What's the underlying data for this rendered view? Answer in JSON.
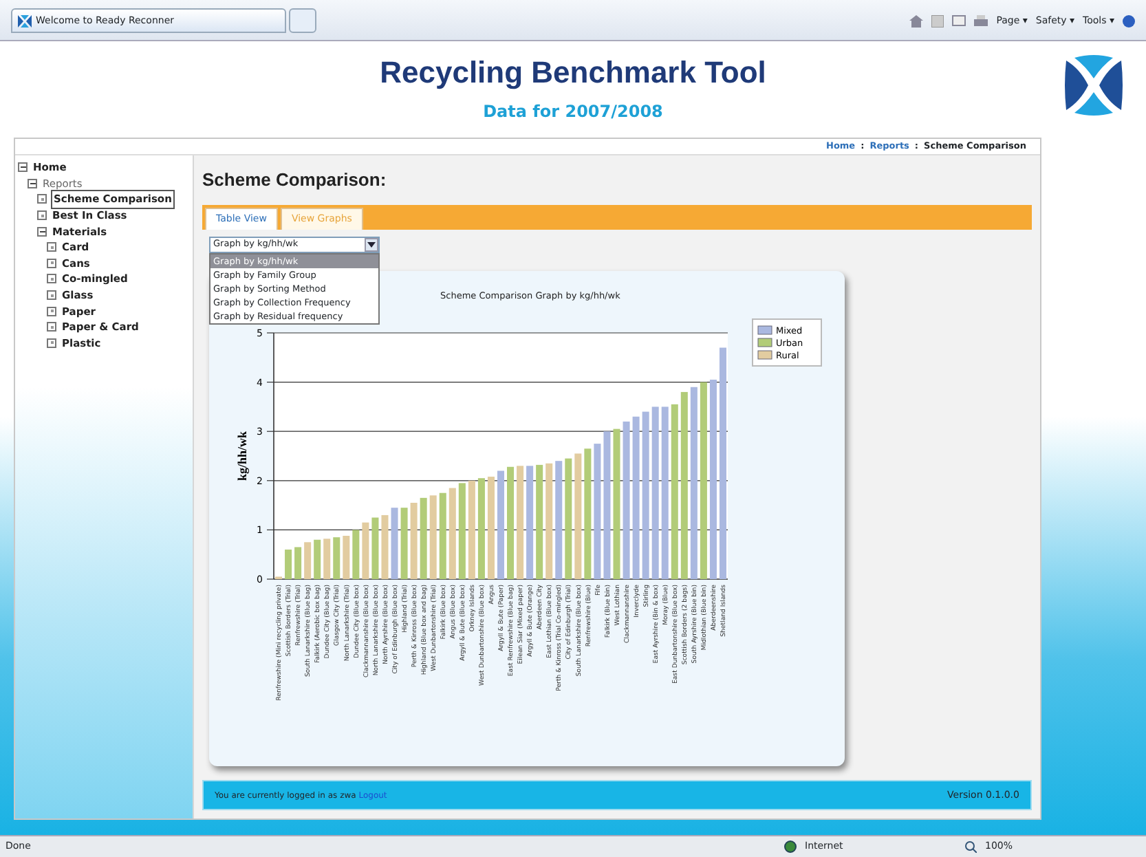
{
  "browser": {
    "tab_title": "Welcome to Ready Reconner",
    "toolbar": [
      "Page ▾",
      "Safety ▾",
      "Tools ▾"
    ],
    "status": "Done",
    "zone": "Internet",
    "zoom": "100%"
  },
  "header": {
    "title": "Recycling Benchmark Tool",
    "subtitle": "Data for 2007/2008"
  },
  "breadcrumb": {
    "items": [
      "Home",
      "Reports",
      "Scheme Comparison"
    ],
    "separator": ":"
  },
  "sidebar": {
    "items": [
      {
        "label": "Home",
        "expanded": true,
        "selected": false,
        "children": [
          {
            "label": "Reports",
            "expanded": true,
            "selected": false,
            "children": [
              {
                "label": "Scheme Comparison",
                "selected": true
              },
              {
                "label": "Best In Class",
                "selected": false
              },
              {
                "label": "Materials",
                "expanded": true,
                "selected": false,
                "children": [
                  {
                    "label": "Card",
                    "selected": false
                  },
                  {
                    "label": "Cans",
                    "selected": false
                  },
                  {
                    "label": "Co-mingled",
                    "selected": false
                  },
                  {
                    "label": "Glass",
                    "selected": false
                  },
                  {
                    "label": "Paper",
                    "selected": false
                  },
                  {
                    "label": "Paper & Card",
                    "selected": false
                  },
                  {
                    "label": "Plastic",
                    "selected": false
                  }
                ]
              }
            ]
          }
        ]
      }
    ]
  },
  "page_title": "Scheme Comparison:",
  "tabs": [
    {
      "label": "Table View",
      "selected": false
    },
    {
      "label": "View Graphs",
      "selected": true
    }
  ],
  "graph_select": {
    "value": "Graph by kg/hh/wk",
    "expanded": true,
    "options": [
      {
        "label": "Graph by kg/hh/wk",
        "selected": true
      },
      {
        "label": "Graph by Family Group",
        "selected": false
      },
      {
        "label": "Graph by Sorting Method",
        "selected": false
      },
      {
        "label": "Graph by Collection Frequency",
        "selected": false
      },
      {
        "label": "Graph by Residual frequency",
        "selected": false
      }
    ]
  },
  "chart": {
    "chart_data": {
      "type": "bar",
      "title": "Scheme Comparison Graph by kg/hh/wk",
      "ylabel": "kg/hh/wk",
      "ylim": [
        0,
        5
      ],
      "yticks": [
        0,
        1,
        2,
        3,
        4,
        5
      ],
      "grid": true,
      "legend": true,
      "categories": [
        "Renfrewshire (Mini recycling private)",
        "Scottish Borders (Trial)",
        "Renfrewshire (Trial)",
        "South Lanarkshire (Blue bag)",
        "Falkirk (Aerobic box bag)",
        "Dundee City (Blue bag)",
        "Glasgow City (Trial)",
        "North Lanarkshire (Trial)",
        "Dundee City (Blue box)",
        "Clackmannanshire (Blue box)",
        "North Lanarkshire (Blue box)",
        "North Ayrshire (Blue box)",
        "City of Edinburgh (Blue box)",
        "Highland (Trial)",
        "Perth & Kinross (Blue box)",
        "Highland (Blue box and bag)",
        "West Dunbartonshire (Trial)",
        "Falkirk (Blue box)",
        "Angus (Blue box)",
        "Argyll & Bute (Blue box)",
        "Orkney Islands",
        "West Dunbartonshire (Blue box)",
        "Angus",
        "Argyll & Bute (Paper)",
        "East Renfrewshire (Blue bag)",
        "Eilean Siar (Mixed paper)",
        "Argyll & Bute (Orange)",
        "Aberdeen City",
        "East Lothian (Blue box)",
        "Perth & Kinross (Trial Co-mingled)",
        "City of Edinburgh (Trial)",
        "South Lanarkshire (Blue box)",
        "Renfrewshire (Blue)",
        "Fife",
        "Falkirk (Blue bin)",
        "West Lothian",
        "Clackmannanshire",
        "Inverclyde",
        "Stirling",
        "East Ayrshire (Bin & box)",
        "Moray (Blue)",
        "East Dunbartonshire (Blue box)",
        "Scottish Borders (2 bags)",
        "South Ayrshire (Blue bin)",
        "Midlothian (Blue bin)",
        "Aberdeenshire",
        "Shetland Islands"
      ],
      "series": [
        {
          "name": "Mixed",
          "color": "#aab8e0",
          "values": [
            null,
            null,
            null,
            null,
            null,
            null,
            null,
            null,
            null,
            null,
            null,
            null,
            1.45,
            null,
            null,
            null,
            null,
            null,
            null,
            null,
            null,
            null,
            null,
            2.2,
            null,
            null,
            2.3,
            null,
            null,
            2.4,
            null,
            null,
            null,
            2.75,
            3.0,
            null,
            3.2,
            3.3,
            3.4,
            3.5,
            3.5,
            null,
            null,
            3.9,
            null,
            4.05,
            4.7
          ]
        },
        {
          "name": "Urban",
          "color": "#b2cc78",
          "values": [
            null,
            0.6,
            0.65,
            null,
            0.8,
            null,
            0.85,
            null,
            1.0,
            null,
            1.25,
            null,
            null,
            1.45,
            null,
            1.65,
            null,
            1.75,
            null,
            1.95,
            null,
            2.05,
            null,
            null,
            2.28,
            null,
            null,
            2.32,
            null,
            null,
            2.45,
            null,
            2.65,
            null,
            null,
            3.05,
            null,
            null,
            null,
            null,
            null,
            3.55,
            3.8,
            null,
            4.0,
            null,
            null
          ]
        },
        {
          "name": "Rural",
          "color": "#e2cca0",
          "values": [
            0.05,
            null,
            null,
            0.75,
            null,
            0.82,
            null,
            0.88,
            null,
            1.15,
            null,
            1.3,
            null,
            null,
            1.55,
            null,
            1.7,
            null,
            1.85,
            null,
            2.0,
            null,
            2.08,
            null,
            null,
            2.3,
            null,
            null,
            2.35,
            null,
            null,
            2.55,
            null,
            null,
            null,
            null,
            null,
            null,
            null,
            null,
            null,
            null,
            null,
            null,
            null,
            null,
            null
          ]
        }
      ]
    }
  },
  "footer": {
    "login_text": "You are currently logged in as zwa",
    "logout": "Logout",
    "version": "Version 0.1.0.0"
  }
}
